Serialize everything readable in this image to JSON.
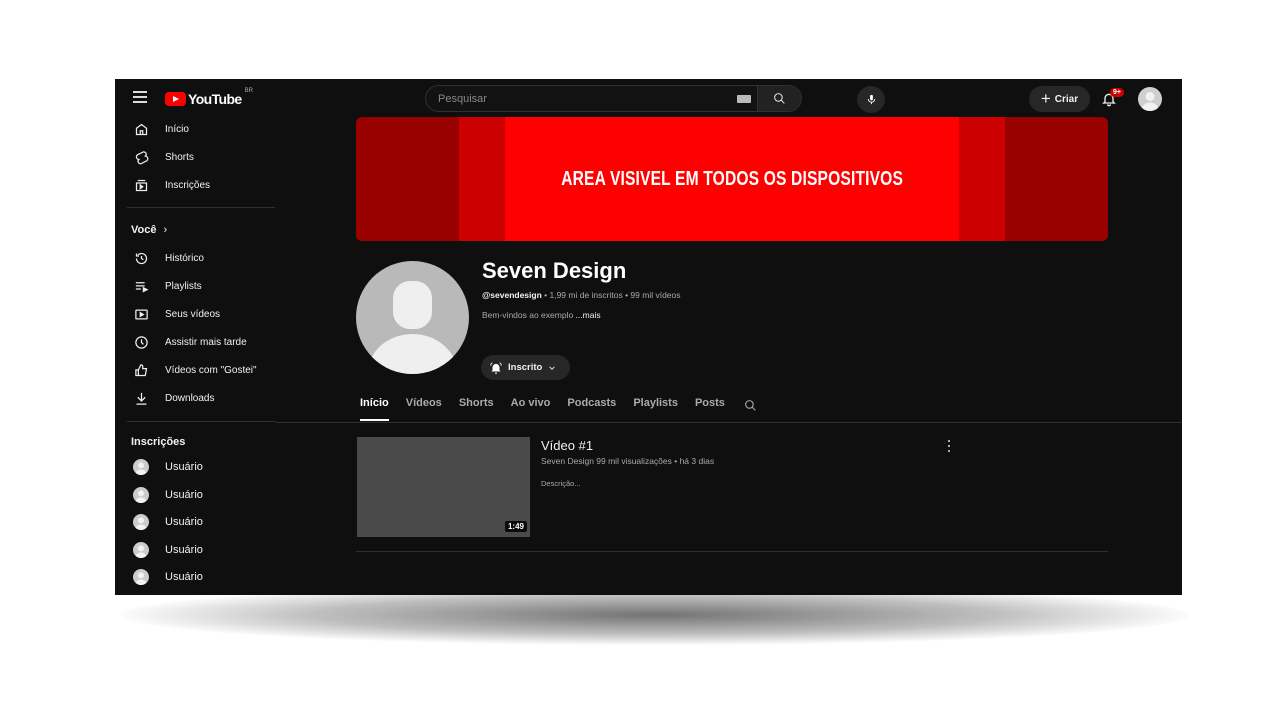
{
  "header": {
    "logo_text": "YouTube",
    "country": "BR",
    "search_placeholder": "Pesquisar",
    "create_label": "Criar",
    "notification_count": "9+"
  },
  "sidebar": {
    "main": [
      {
        "label": "Início",
        "icon": "home-icon"
      },
      {
        "label": "Shorts",
        "icon": "shorts-icon"
      },
      {
        "label": "Inscrições",
        "icon": "subscriptions-icon"
      }
    ],
    "you_title": "Você",
    "you": [
      {
        "label": "Histórico",
        "icon": "history-icon"
      },
      {
        "label": "Playlists",
        "icon": "playlists-icon"
      },
      {
        "label": "Seus vídeos",
        "icon": "your-videos-icon"
      },
      {
        "label": "Assistir mais tarde",
        "icon": "clock-icon"
      },
      {
        "label": "Vídeos com \"Gostei\"",
        "icon": "thumbs-up-icon"
      },
      {
        "label": "Downloads",
        "icon": "download-icon"
      }
    ],
    "subs_title": "Inscrições",
    "subscriptions": [
      "Usuário",
      "Usuário",
      "Usuário",
      "Usuário",
      "Usuário"
    ]
  },
  "channel": {
    "banner_text": "AREA VISIVEL EM TODOS OS DISPOSITIVOS",
    "name": "Seven Design",
    "handle": "@sevendesign",
    "meta": " • 1,99 mi de inscritos • 99 mil vídeos",
    "description": "Bem-vindos ao exemplo ",
    "more": "...mais",
    "subscribed_label": "Inscrito"
  },
  "tabs": [
    {
      "label": "Início",
      "active": true
    },
    {
      "label": "Vídeos",
      "active": false
    },
    {
      "label": "Shorts",
      "active": false
    },
    {
      "label": "Ao vivo",
      "active": false
    },
    {
      "label": "Podcasts",
      "active": false
    },
    {
      "label": "Playlists",
      "active": false
    },
    {
      "label": "Posts",
      "active": false
    }
  ],
  "video": {
    "title": "Vídeo #1",
    "meta": "Seven Design 99 mil visualizações • há 3 dias",
    "description": "Descrição...",
    "duration": "1:49"
  },
  "colors": {
    "background": "#0f0f0f",
    "brand_red": "#ff0000",
    "banner_dark": "#990000",
    "banner_mid": "#cc0000"
  }
}
